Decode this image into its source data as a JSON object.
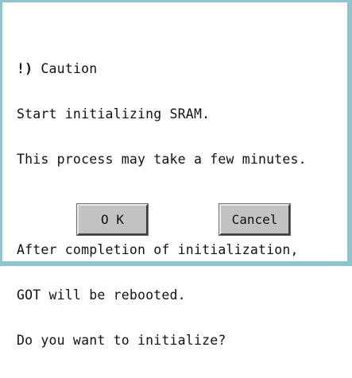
{
  "dialog": {
    "caution_mark": "!)",
    "caution_title": " Caution",
    "lines": [
      "Start initializing SRAM.",
      "This process may take a few minutes.",
      "",
      "After completion of initialization,",
      "GOT will be rebooted.",
      "Do you want to initialize?"
    ],
    "ok_label": "O K",
    "cancel_label": "Cancel"
  },
  "colors": {
    "frame": "#8fc3cf",
    "button_face": "#c2c2c2",
    "background": "#ffffff",
    "text": "#111111"
  }
}
